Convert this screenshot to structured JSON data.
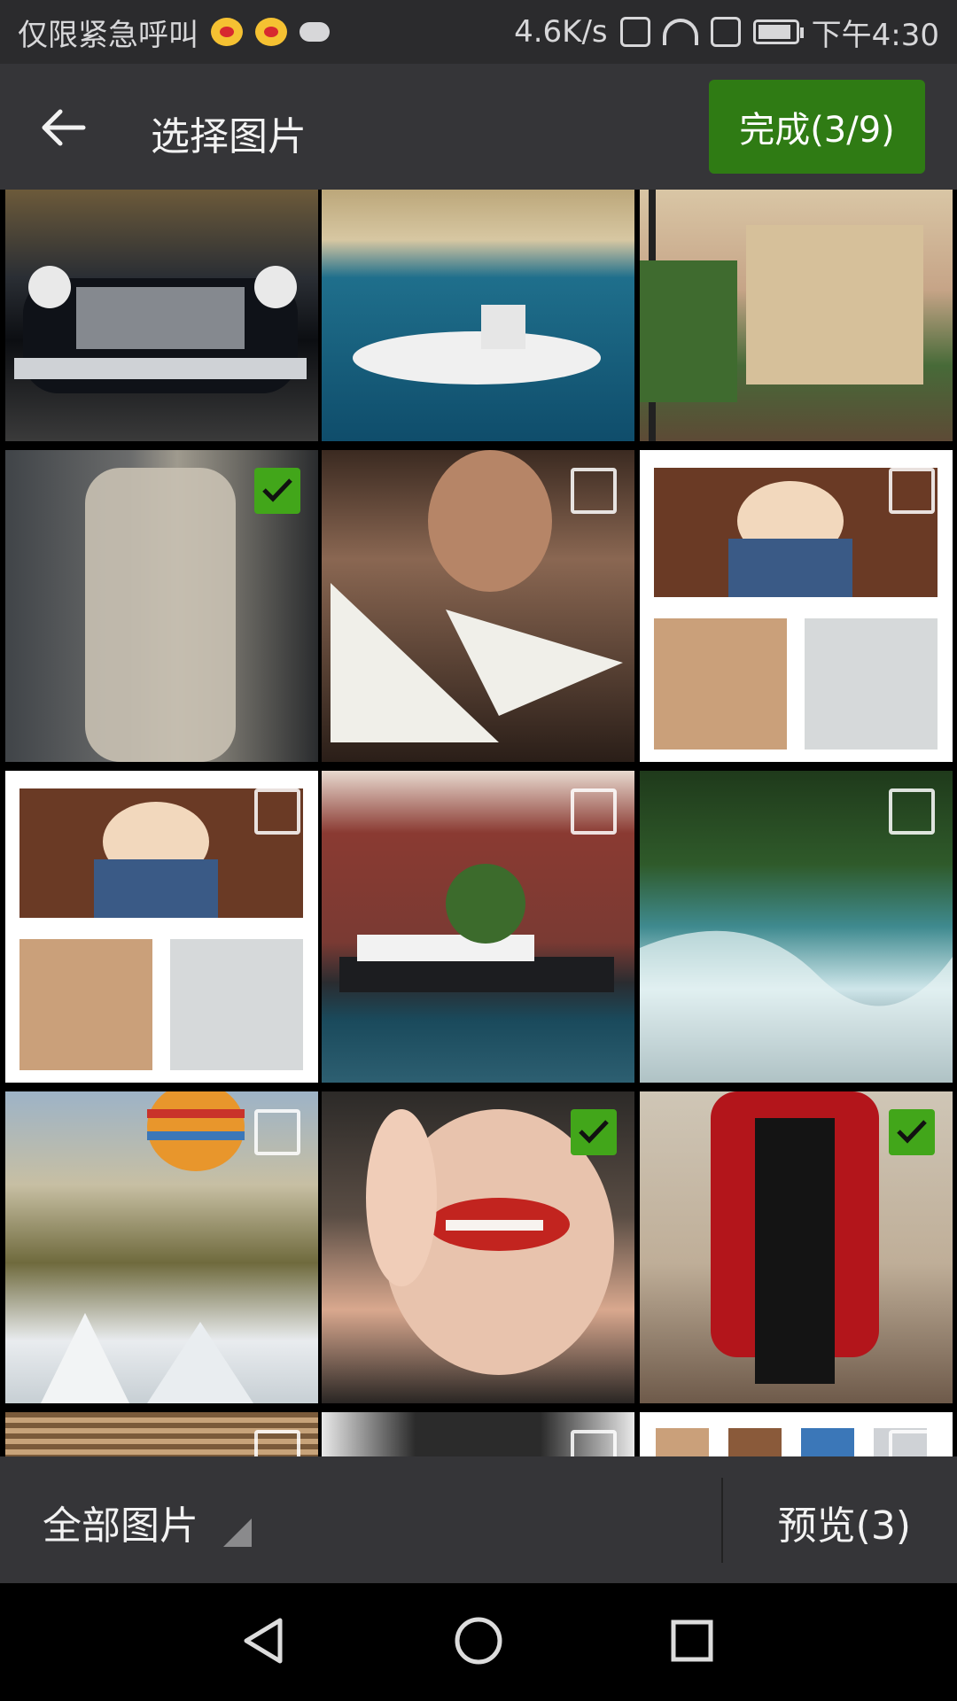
{
  "status_bar": {
    "left_text": "仅限紧急呼叫",
    "speed": "4.6K/s",
    "time": "下午4:30",
    "icons": [
      "weibo-icon",
      "weibo-icon",
      "cloud-upload-icon",
      "vibrate-icon",
      "wifi-icon",
      "alert-icon",
      "battery-icon"
    ]
  },
  "header": {
    "title": "选择图片",
    "done_label": "完成(3/9)",
    "back_icon": "back-arrow-icon"
  },
  "grid": {
    "items": [
      {
        "subject": "vintage black car",
        "selected": false,
        "partial": true
      },
      {
        "subject": "harbor with boat",
        "selected": false,
        "partial": true
      },
      {
        "subject": "old town street",
        "selected": false,
        "partial": true
      },
      {
        "subject": "woman in beige coat",
        "selected": true
      },
      {
        "subject": "man with ship model",
        "selected": false
      },
      {
        "subject": "girl collage",
        "selected": false
      },
      {
        "subject": "girl collage",
        "selected": false
      },
      {
        "subject": "red brick buildings and boat",
        "selected": false
      },
      {
        "subject": "river rapids in forest",
        "selected": false
      },
      {
        "subject": "hot air balloon over rocks",
        "selected": false
      },
      {
        "subject": "smiling woman with red lips",
        "selected": true
      },
      {
        "subject": "woman in red jacket",
        "selected": true
      },
      {
        "subject": "wooden blinds",
        "selected": false,
        "partial": true
      },
      {
        "subject": "woman portrait",
        "selected": false,
        "partial": true
      },
      {
        "subject": "collage",
        "selected": false,
        "partial": true
      }
    ],
    "accent_check": "#42a61a"
  },
  "footer": {
    "album_label": "全部图片",
    "preview_label": "预览(3)"
  },
  "nav": {
    "back": "nav-back-icon",
    "home": "nav-home-icon",
    "recent": "nav-recent-icon"
  },
  "colors": {
    "bar": "#353538",
    "status": "#2b2b2d",
    "done_button": "#2f7b14"
  }
}
